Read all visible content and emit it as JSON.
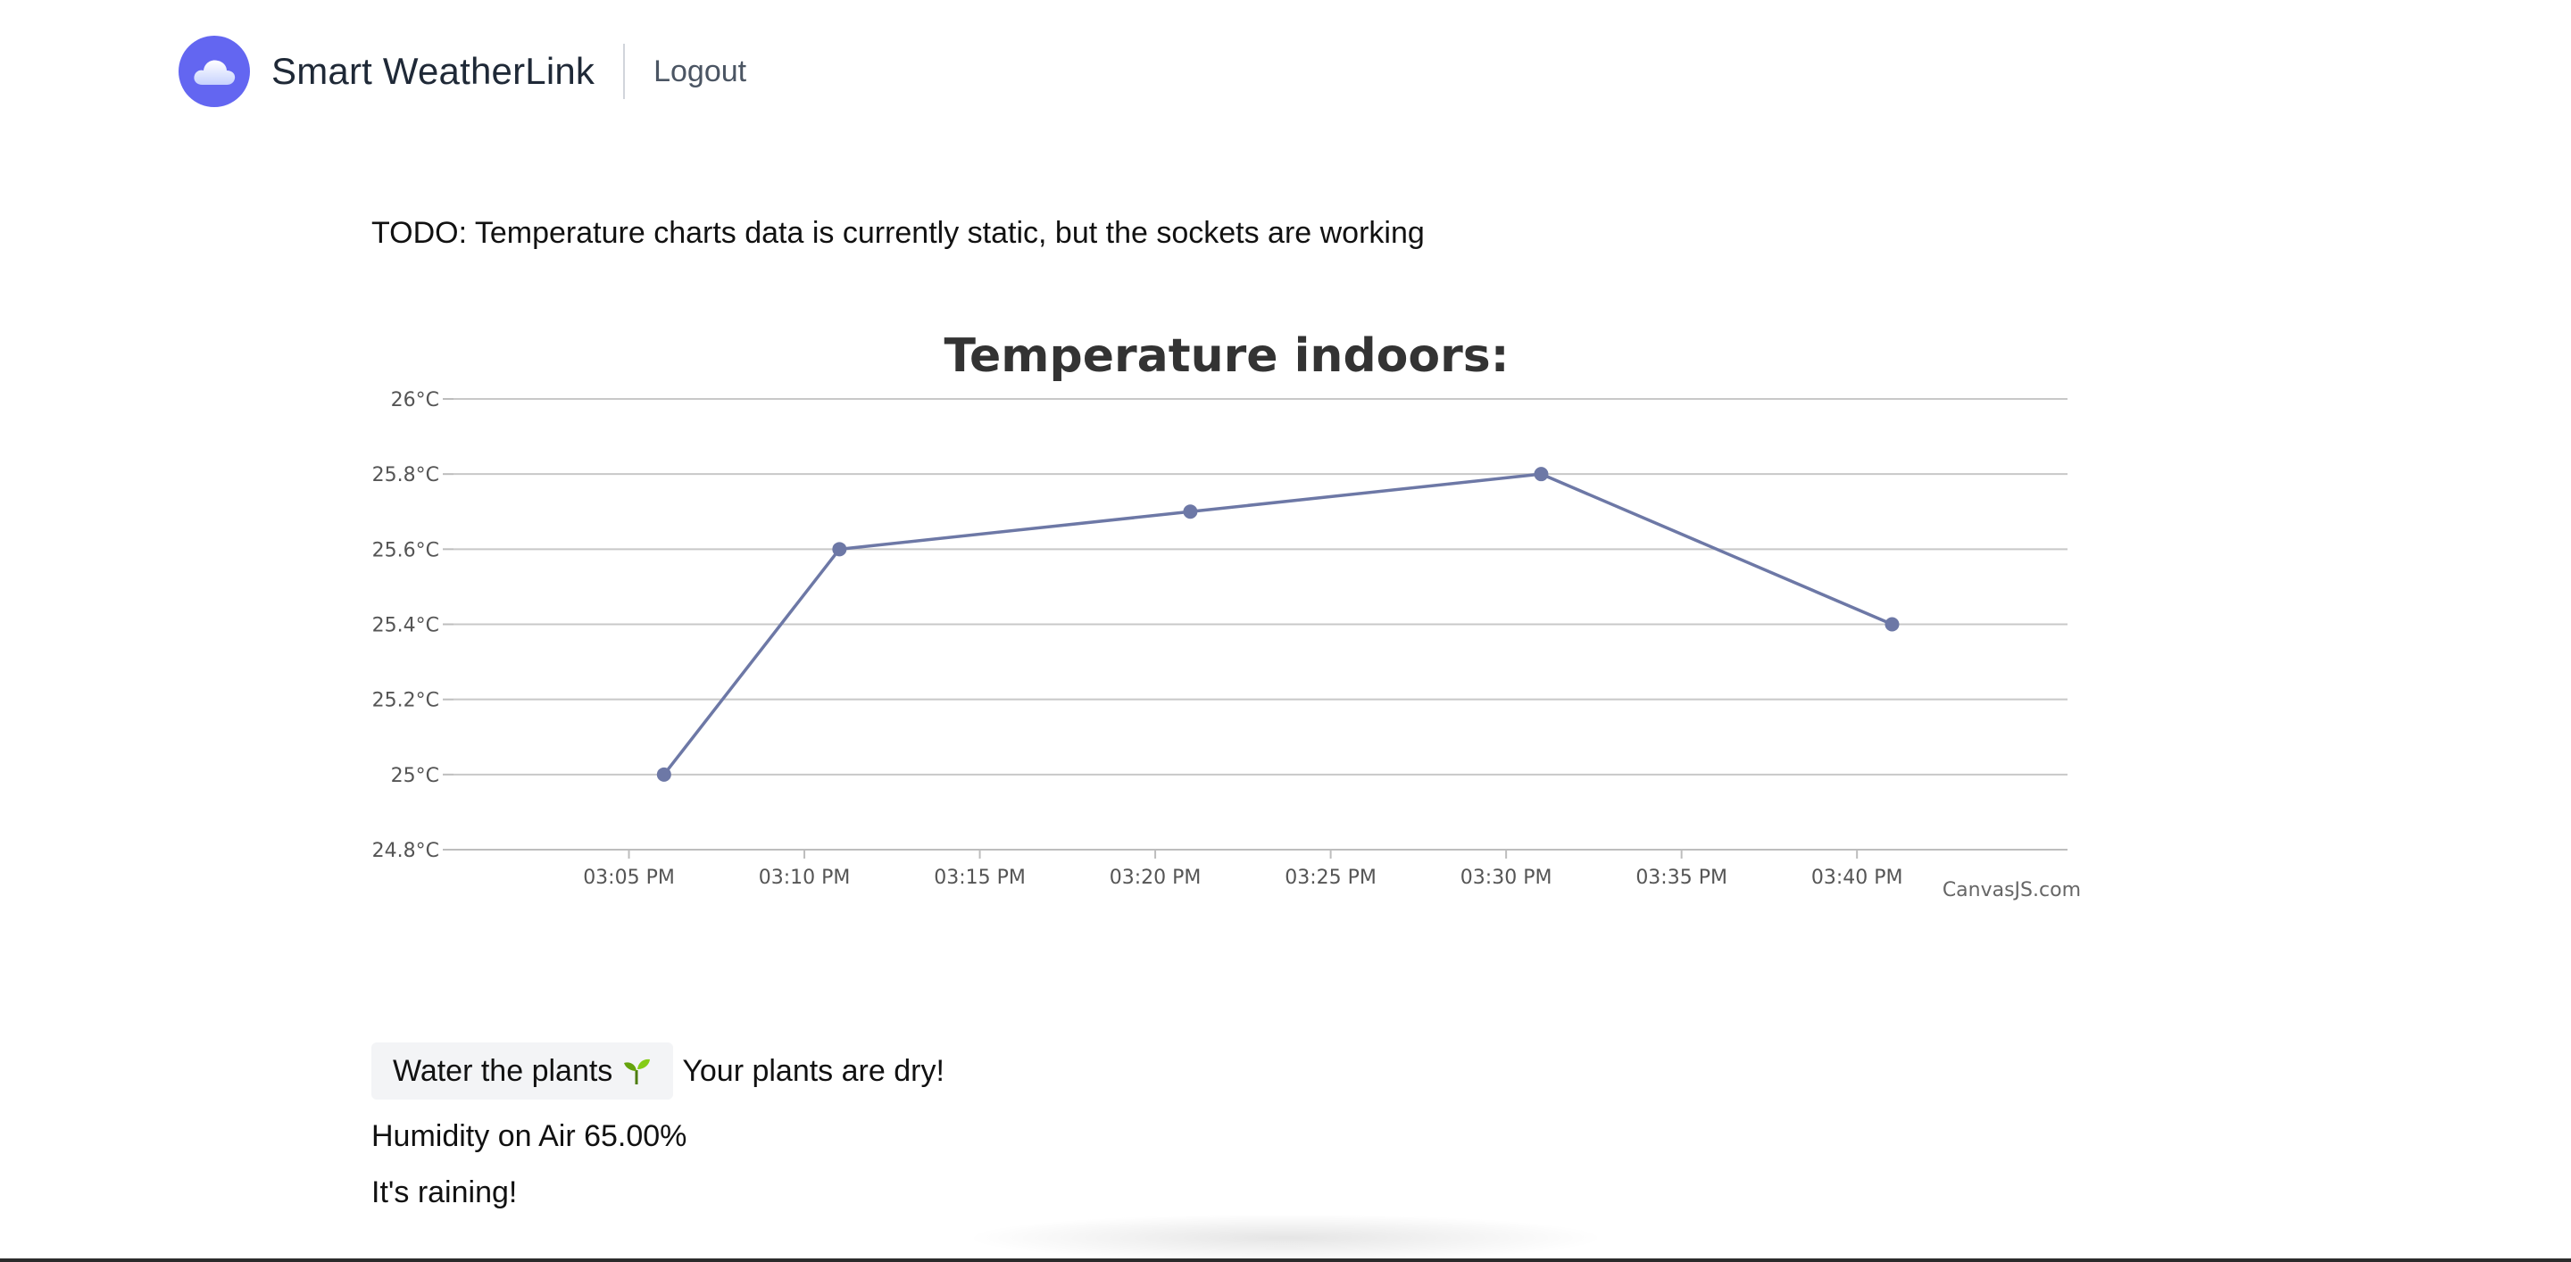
{
  "header": {
    "app_title": "Smart WeatherLink",
    "logout_label": "Logout",
    "logo_icon": "cloud-icon",
    "brand_color": "#6366f1"
  },
  "main": {
    "todo_text": "TODO: Temperature charts data is currently static, but the sockets are working",
    "water_button_label": "Water the plants",
    "water_button_icon": "sprout-icon",
    "plants_status": "Your plants are dry!",
    "humidity_text": "Humidity on Air 65.00%",
    "rain_text": "It's raining!"
  },
  "chart_data": {
    "type": "line",
    "title": "Temperature indoors:",
    "xlabel": "",
    "ylabel": "",
    "x": [
      "03:06 PM",
      "03:11 PM",
      "03:21 PM",
      "03:31 PM",
      "03:41 PM"
    ],
    "x_minutes": [
      6,
      11,
      21,
      31,
      41
    ],
    "series": [
      {
        "values": [
          25.0,
          25.6,
          25.7,
          25.8,
          25.4
        ],
        "color": "#6d78a6"
      }
    ],
    "ylim": [
      24.8,
      26.0
    ],
    "yticks": [
      "24.8°C",
      "25°C",
      "25.2°C",
      "25.4°C",
      "25.6°C",
      "25.8°C",
      "26°C"
    ],
    "ytick_values": [
      24.8,
      25.0,
      25.2,
      25.4,
      25.6,
      25.8,
      26.0
    ],
    "xticks": [
      "03:05 PM",
      "03:10 PM",
      "03:15 PM",
      "03:20 PM",
      "03:25 PM",
      "03:30 PM",
      "03:35 PM",
      "03:40 PM"
    ],
    "xtick_minutes": [
      5,
      10,
      15,
      20,
      25,
      30,
      35,
      40
    ],
    "grid": true,
    "credit": "CanvasJS.com"
  }
}
